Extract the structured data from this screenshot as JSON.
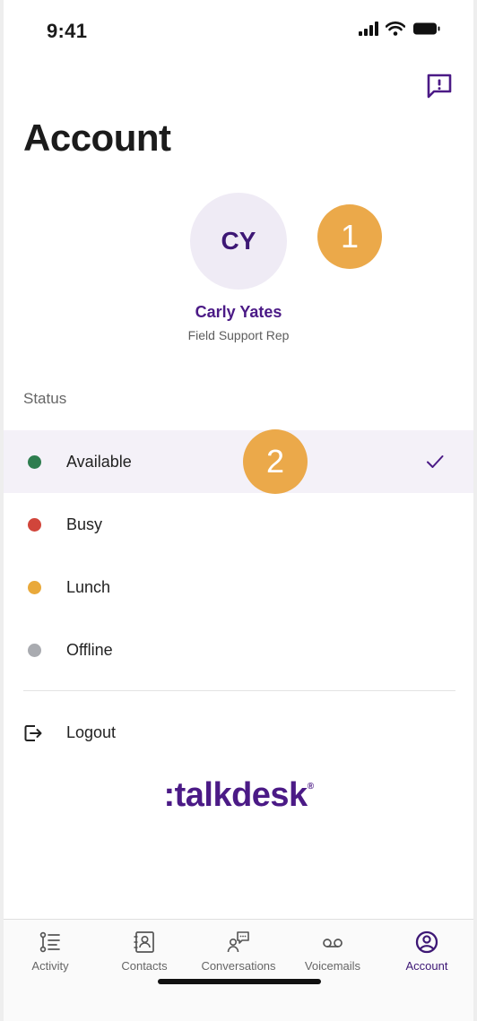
{
  "status_bar": {
    "time": "9:41"
  },
  "header": {
    "title": "Account",
    "feedback_icon": "message-alert-icon"
  },
  "profile": {
    "initials": "CY",
    "name": "Carly Yates",
    "role": "Field Support Rep"
  },
  "markers": [
    "1",
    "2"
  ],
  "status_section": {
    "label": "Status",
    "items": [
      {
        "label": "Available",
        "color": "#2e7d4f",
        "selected": true
      },
      {
        "label": "Busy",
        "color": "#d1453b",
        "selected": false
      },
      {
        "label": "Lunch",
        "color": "#e9a93b",
        "selected": false
      },
      {
        "label": "Offline",
        "color": "#a9abb0",
        "selected": false
      }
    ]
  },
  "logout": {
    "label": "Logout",
    "icon": "logout-icon"
  },
  "brand": {
    "logo_text": ":talkdesk",
    "reg_mark": "®"
  },
  "colors": {
    "accent": "#4b1a86",
    "marker": "#eba94a",
    "avatar_bg": "#efebf5"
  },
  "tabbar": {
    "tabs": [
      {
        "label": "Activity",
        "icon": "activity-icon",
        "active": false
      },
      {
        "label": "Contacts",
        "icon": "contacts-icon",
        "active": false
      },
      {
        "label": "Conversations",
        "icon": "conversations-icon",
        "active": false
      },
      {
        "label": "Voicemails",
        "icon": "voicemail-icon",
        "active": false
      },
      {
        "label": "Account",
        "icon": "account-icon",
        "active": true
      }
    ]
  }
}
